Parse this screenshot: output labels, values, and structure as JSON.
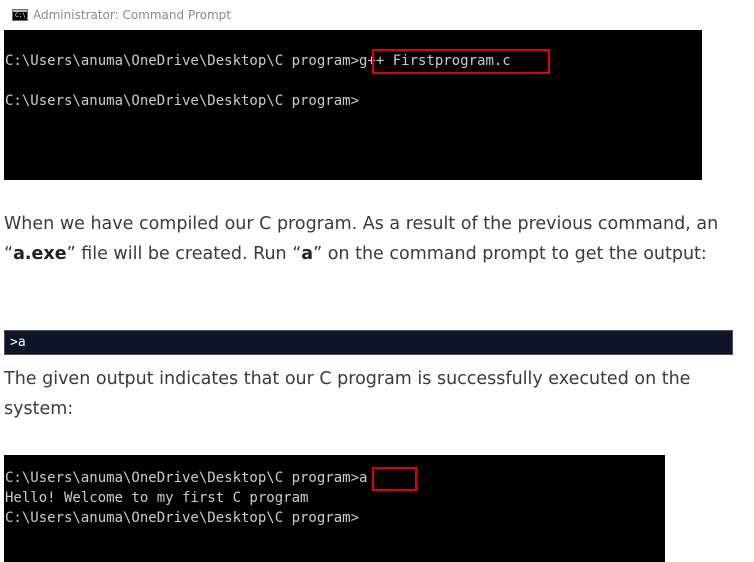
{
  "window": {
    "icon_glyph": "C:\\_",
    "title": "Administrator: Command Prompt"
  },
  "terminal1": {
    "prompt": "C:\\Users\\anuma\\OneDrive\\Desktop\\C program",
    "command": ">g++ Firstprogram.c",
    "line2": "C:\\Users\\anuma\\OneDrive\\Desktop\\C program>"
  },
  "paragraph1": {
    "part1": "When we have compiled our C program. As a result of the previous command, an “",
    "bold1": "a.exe",
    "part2": "” file will be created. Run “",
    "bold2": "a",
    "part3": "” on the command prompt to get the output:"
  },
  "code_block": {
    "text": ">a"
  },
  "paragraph2": {
    "text": "The given output indicates that our C program is successfully executed on the system:"
  },
  "terminal2": {
    "prompt": "C:\\Users\\anuma\\OneDrive\\Desktop\\C program",
    "command": ">a",
    "output": "Hello! Welcome to my first C program",
    "line3": "C:\\Users\\anuma\\OneDrive\\Desktop\\C program>"
  },
  "colors": {
    "terminal_bg": "#000000",
    "terminal_text": "#cccccc",
    "highlight_border": "#e00000",
    "code_bar_bg": "#0d1526",
    "prose_text": "#3a3a3a"
  }
}
